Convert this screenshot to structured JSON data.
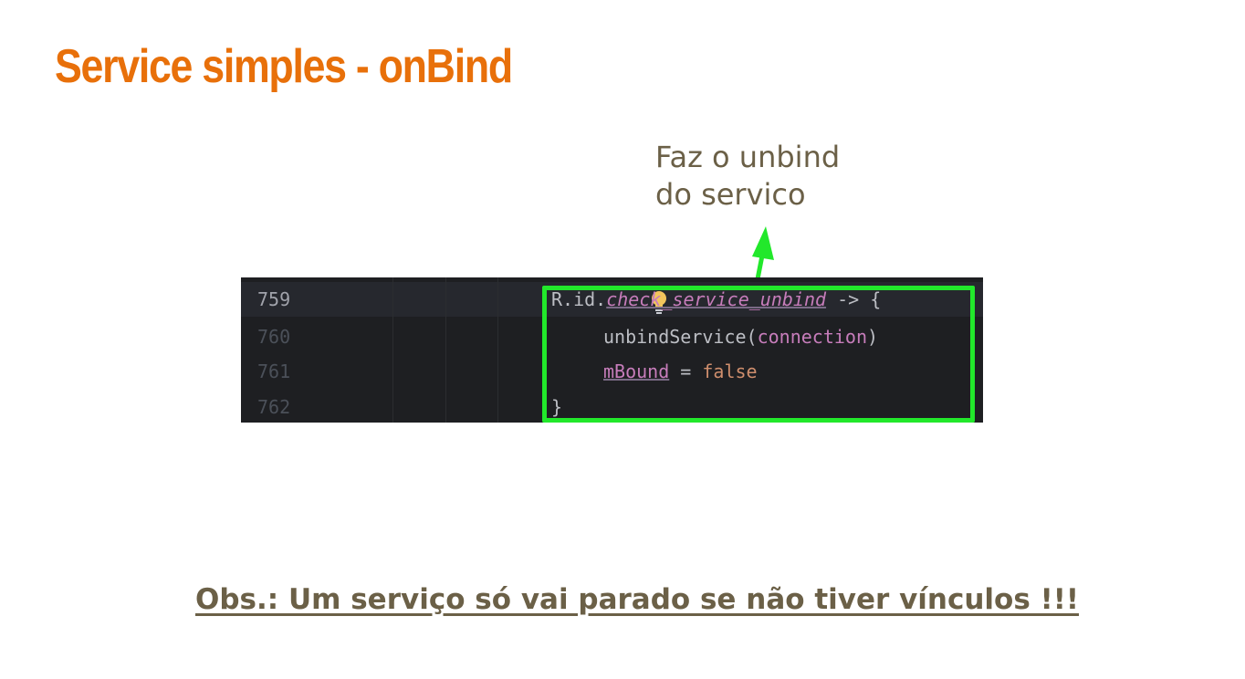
{
  "slide": {
    "title": "Service simples - onBind",
    "annotation_line1": "Faz o unbind",
    "annotation_line2": "do servico",
    "note": "Obs.: Um serviço só vai parado se não tiver vínculos !!!"
  },
  "colors": {
    "title": "#e8700a",
    "annotation": "#6b6047",
    "note": "#6b6047",
    "highlight": "#22e82b",
    "editor_background": "#1e1f22"
  },
  "editor": {
    "lines": [
      {
        "number": "759",
        "current": true,
        "icon": "lightbulb-icon",
        "parts": {
          "p1": "R.id.",
          "p2": "check_service_unbind",
          "p3": " -> {"
        }
      },
      {
        "number": "760",
        "parts": {
          "p1": "unbindService(",
          "p2": "connection",
          "p3": ")"
        }
      },
      {
        "number": "761",
        "parts": {
          "p1": "mBound",
          "p2": " = ",
          "p3": "false"
        }
      },
      {
        "number": "762",
        "parts": {
          "p1": "}"
        }
      }
    ]
  }
}
